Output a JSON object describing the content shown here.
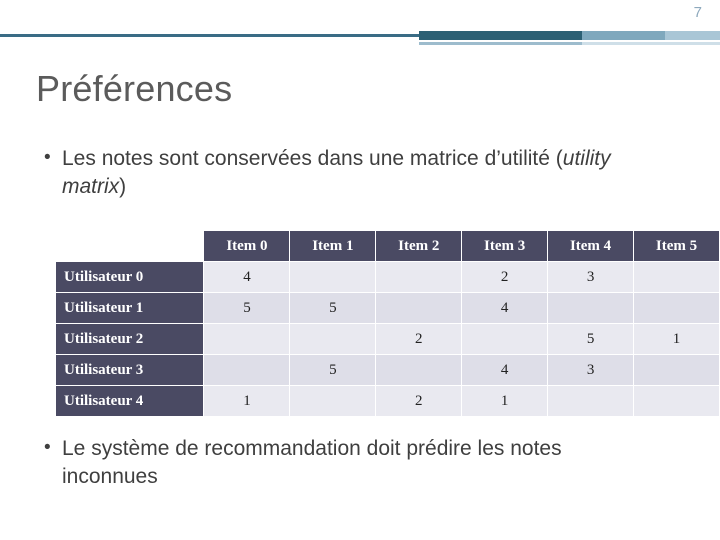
{
  "slide": {
    "number": "7",
    "title": "Préférences",
    "bullets": [
      {
        "marker": "•",
        "text_plain": "Les notes sont conservées dans une matrice d’utilité (utility matrix)",
        "segments": [
          {
            "text": "Les notes sont conservées dans une matrice d’utilité (",
            "italic": false
          },
          {
            "text": "utility matrix",
            "italic": true
          },
          {
            "text": ")",
            "italic": false
          }
        ]
      },
      {
        "marker": "•",
        "text_plain": "Le système de recommandation doit prédire les notes inconnues",
        "segments": [
          {
            "text": "Le système de recommandation doit prédire les notes inconnues",
            "italic": false
          }
        ]
      }
    ]
  },
  "matrix": {
    "corner_label": "",
    "columns": [
      "Item 0",
      "Item 1",
      "Item 2",
      "Item 3",
      "Item 4",
      "Item 5"
    ],
    "rows": [
      {
        "label": "Utilisateur 0",
        "values": [
          "4",
          "",
          "",
          "2",
          "3",
          ""
        ]
      },
      {
        "label": "Utilisateur 1",
        "values": [
          "5",
          "5",
          "",
          "4",
          "",
          ""
        ]
      },
      {
        "label": "Utilisateur 2",
        "values": [
          "",
          "",
          "2",
          "",
          "5",
          "1"
        ]
      },
      {
        "label": "Utilisateur 3",
        "values": [
          "",
          "5",
          "",
          "4",
          "3",
          ""
        ]
      },
      {
        "label": "Utilisateur 4",
        "values": [
          "1",
          "",
          "2",
          "1",
          "",
          ""
        ]
      }
    ]
  },
  "colors": {
    "header_bg": "#4a4a63",
    "cell_odd": "#e9e9f0",
    "cell_even": "#dedee8",
    "title": "#5b5b5b",
    "accent_dark": "#2c6074",
    "accent_light": "#a9c6d6"
  }
}
